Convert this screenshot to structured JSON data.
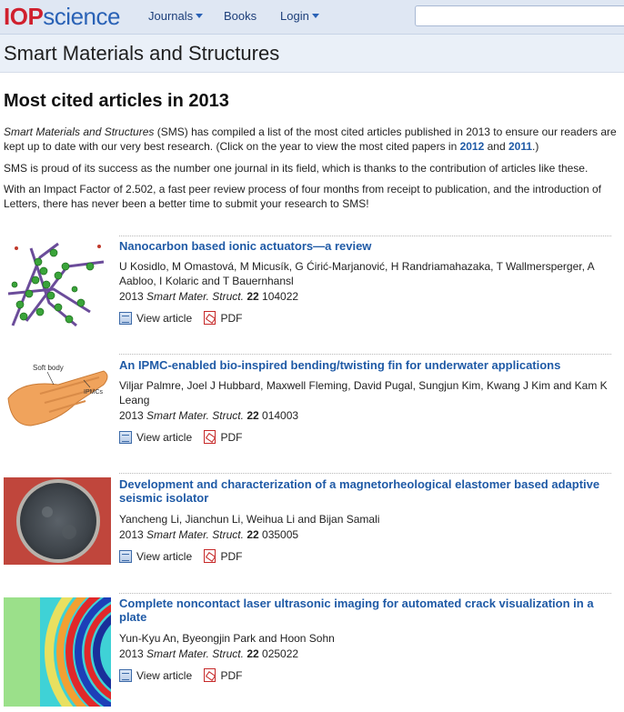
{
  "nav": {
    "logo_iop": "IOP",
    "logo_science": "science",
    "journals": "Journals",
    "books": "Books",
    "login": "Login"
  },
  "journal": {
    "title": "Smart Materials and Structures"
  },
  "page": {
    "title": "Most cited articles in 2013",
    "intro1_journal": "Smart Materials and Structures",
    "intro1_text": " (SMS) has compiled a list of the most cited articles published in 2013 to ensure our readers are kept up to date with our very best research. (Click on the year to view the most cited papers in ",
    "intro1_link1": "2012",
    "intro1_and": " and ",
    "intro1_link2": "2011",
    "intro1_end": ".)",
    "intro2": "SMS is proud of its success as the number one journal in its field, which is thanks to the contribution of articles like these.",
    "intro3": "With an Impact Factor of 2.502, a fast peer review process of four months from receipt to publication, and the introduction of Letters, there has never been a better time to submit your research to SMS!"
  },
  "link_labels": {
    "view": "View article",
    "pdf": "PDF"
  },
  "articles": [
    {
      "title": "Nanocarbon based ionic actuators—a review",
      "authors": "U Kosidlo, M Omastová, M Micusík, G Ćirić-Marjanović, H Randriamahazaka, T Wallmersperger, A Aabloo, I Kolaric and T Bauernhansl",
      "year": "2013",
      "journal": "Smart Mater. Struct.",
      "volume": "22",
      "number": "104022"
    },
    {
      "title": "An IPMC-enabled bio-inspired bending/twisting fin for underwater applications",
      "authors": "Viljar Palmre, Joel J Hubbard, Maxwell Fleming, David Pugal, Sungjun Kim, Kwang J Kim and Kam K Leang",
      "year": "2013",
      "journal": "Smart Mater. Struct.",
      "volume": "22",
      "number": "014003",
      "thumb_label1": "Soft body",
      "thumb_label2": "IPMCs"
    },
    {
      "title": "Development and characterization of a magnetorheological elastomer based adaptive seismic isolator",
      "authors": "Yancheng Li, Jianchun Li, Weihua Li and Bijan Samali",
      "year": "2013",
      "journal": "Smart Mater. Struct.",
      "volume": "22",
      "number": "035005"
    },
    {
      "title": "Complete noncontact laser ultrasonic imaging for automated crack visualization in a plate",
      "authors": "Yun-Kyu An, Byeongjin Park and Hoon Sohn",
      "year": "2013",
      "journal": "Smart Mater. Struct.",
      "volume": "22",
      "number": "025022"
    }
  ]
}
